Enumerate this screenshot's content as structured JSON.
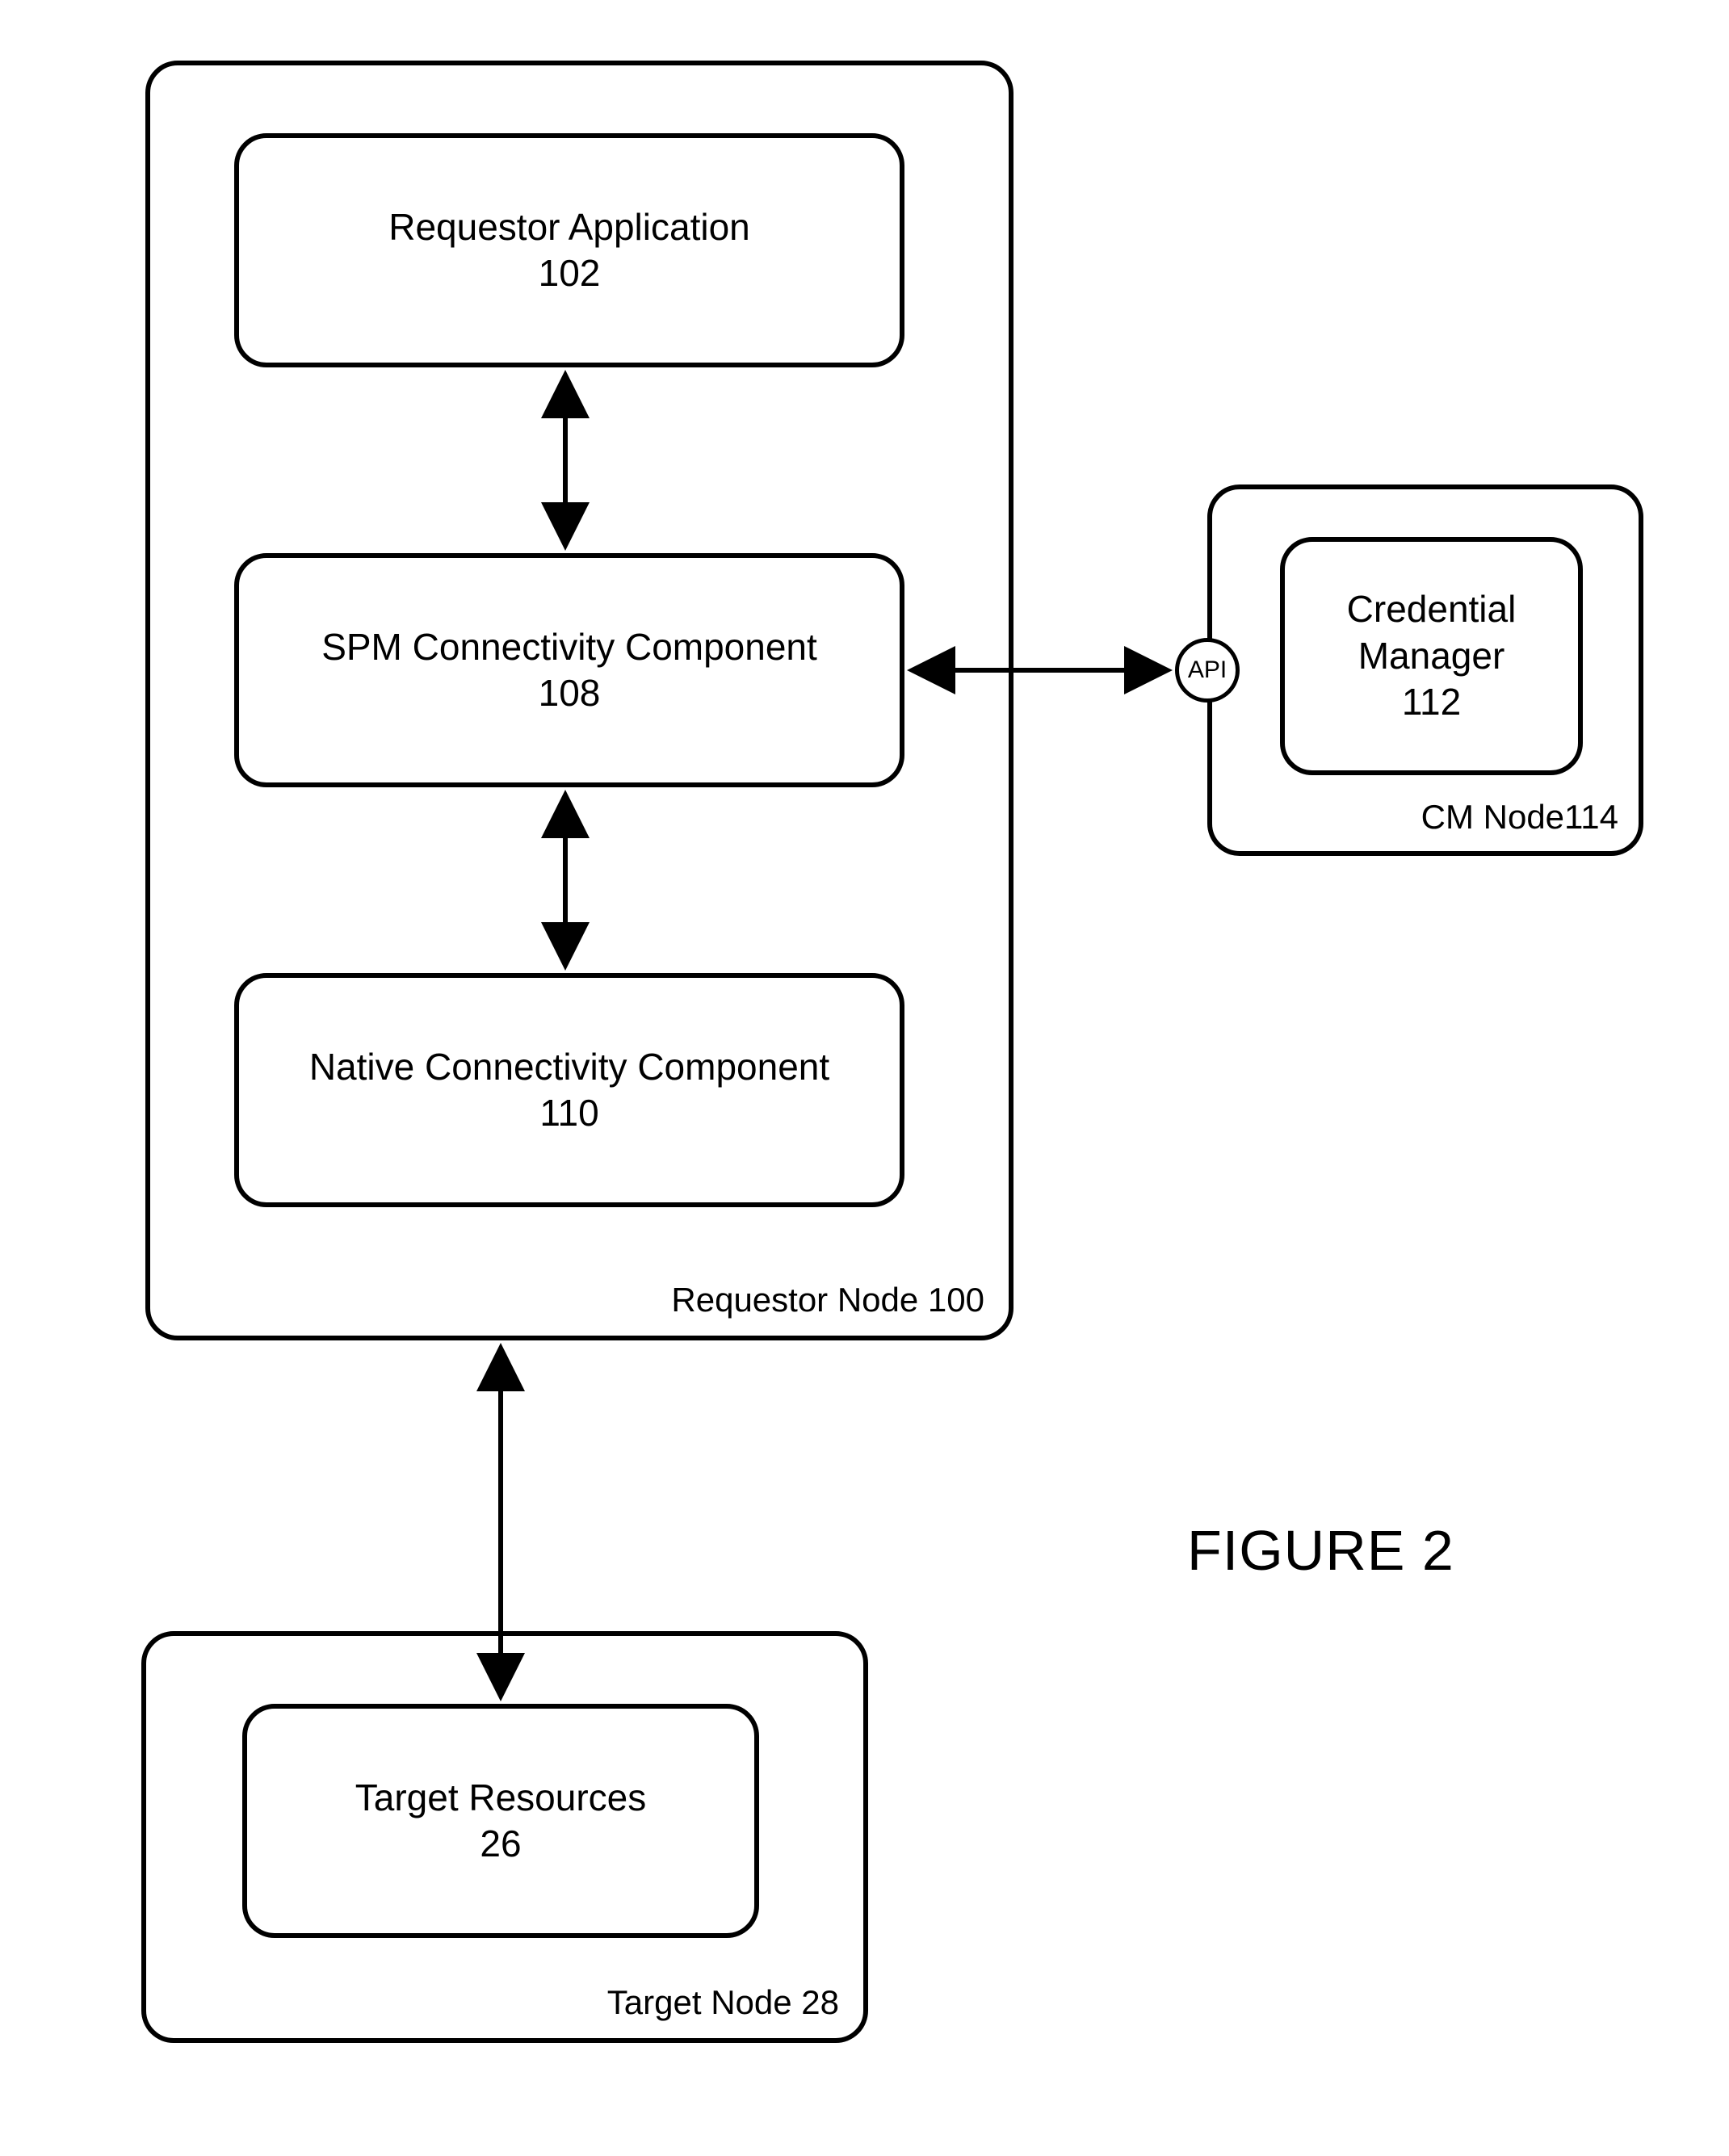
{
  "figure_label": "FIGURE 2",
  "requestor_node": {
    "label": "Requestor Node 100",
    "requestor_app": {
      "title": "Requestor Application",
      "num": "102"
    },
    "spm": {
      "title": "SPM Connectivity Component",
      "num": "108"
    },
    "native": {
      "title": "Native Connectivity Component",
      "num": "110"
    }
  },
  "cm_node": {
    "label": "CM Node114",
    "cred_mgr": {
      "title": "Credential\nManager",
      "num": "112"
    }
  },
  "api_label": "API",
  "target_node": {
    "label": "Target Node 28",
    "target_res": {
      "title": "Target Resources",
      "num": "26"
    }
  }
}
